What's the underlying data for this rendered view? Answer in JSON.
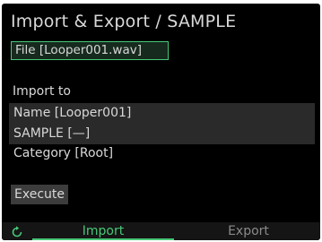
{
  "header": {
    "title": "Import & Export / SAMPLE"
  },
  "file": {
    "label": "File [Looper001.wav]"
  },
  "import_section": {
    "heading": "Import to",
    "rows": [
      {
        "label": "Name [Looper001]"
      },
      {
        "label": "SAMPLE [—]"
      },
      {
        "label": "Category [Root]"
      }
    ]
  },
  "actions": {
    "execute_label": "Execute"
  },
  "tabs": [
    {
      "label": "Import",
      "active": true
    },
    {
      "label": "Export",
      "active": false
    }
  ],
  "icons": {
    "back": "reload-icon"
  },
  "colors": {
    "accent": "#48c878",
    "background": "#000000",
    "text": "#d8d8d8",
    "selected_row": "#2a2a2a"
  }
}
